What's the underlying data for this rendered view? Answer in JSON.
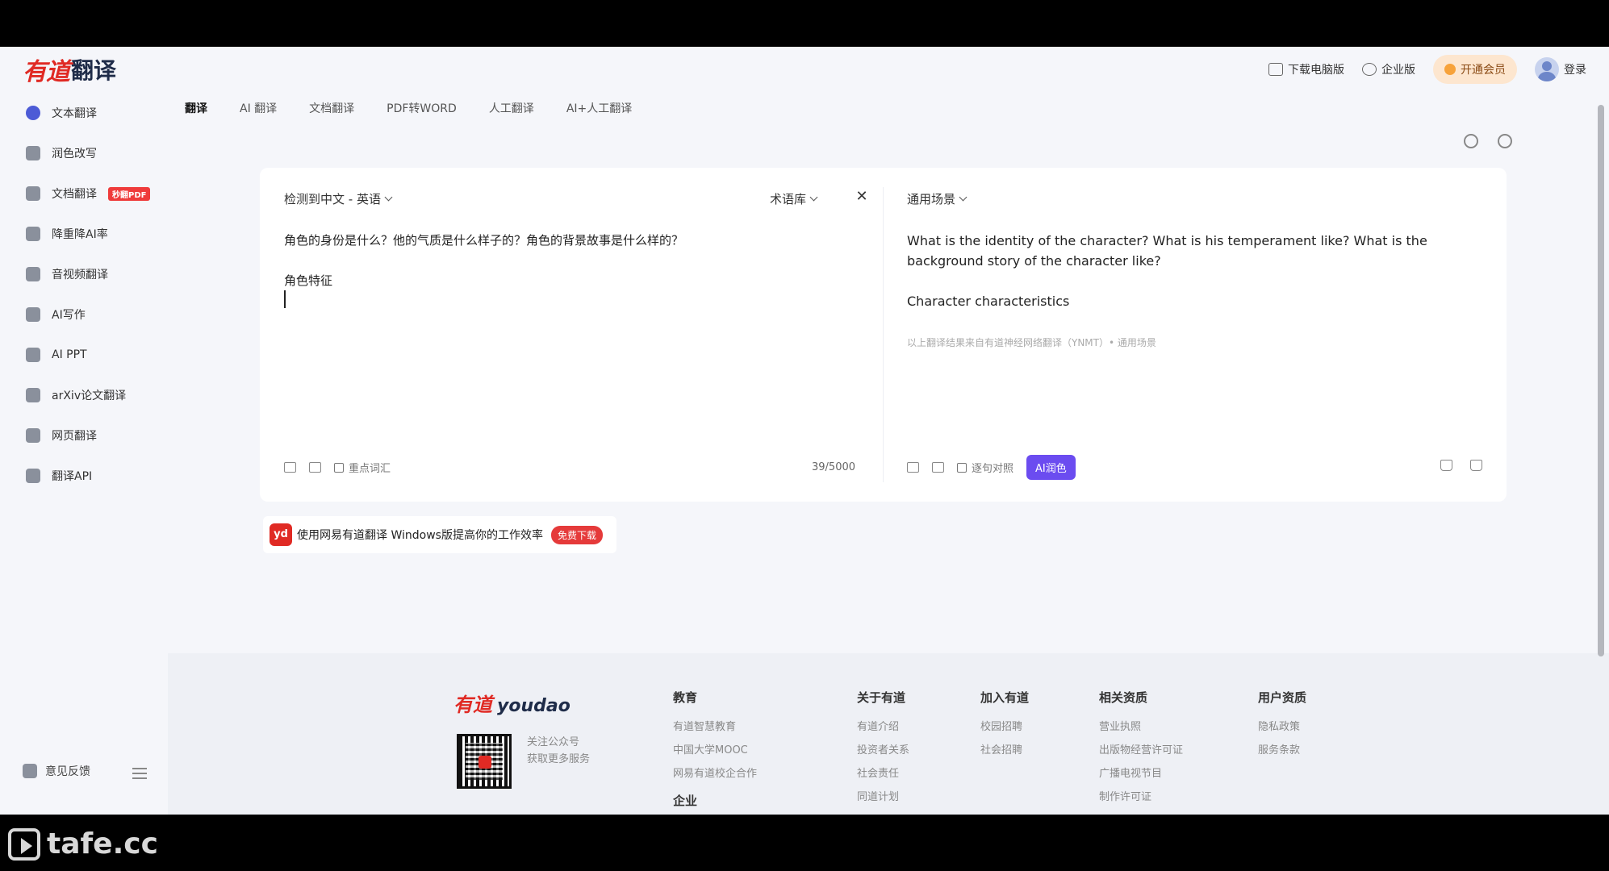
{
  "brand": {
    "logo_mark": "有道",
    "logo_word": "翻译",
    "footer_mark": "有道",
    "footer_word": "youdao"
  },
  "topbar": {
    "download_pc": "下载电脑版",
    "enterprise": "企业版",
    "vip": "开通会员",
    "login": "登录"
  },
  "sidebar": {
    "items": [
      {
        "label": "文本翻译"
      },
      {
        "label": "润色改写"
      },
      {
        "label": "文档翻译",
        "badge": "秒翻PDF"
      },
      {
        "label": "降重降AI率"
      },
      {
        "label": "音视频翻译"
      },
      {
        "label": "AI写作"
      },
      {
        "label": "AI PPT"
      },
      {
        "label": "arXiv论文翻译"
      },
      {
        "label": "网页翻译"
      },
      {
        "label": "翻译API"
      }
    ],
    "feedback": "意见反馈"
  },
  "tabs": [
    "翻译",
    "AI 翻译",
    "文档翻译",
    "PDF转WORD",
    "人工翻译",
    "AI+人工翻译"
  ],
  "source": {
    "lang_detect": "检测到中文 - 英语",
    "glossary": "术语库",
    "clear_icon": "✕",
    "line1": "角色的身份是什么？他的气质是什么样子的？角色的背景故事是什么样的？",
    "line2": "角色特征",
    "key_vocab": "重点词汇",
    "count": "39/5000"
  },
  "target": {
    "scene": "通用场景",
    "line1": "What is the identity of the character? What is his temperament like? What is the background story of the character like?",
    "line2": "Character characteristics",
    "credit": "以上翻译结果来自有道神经网络翻译（YNMT）• 通用场景",
    "sentence_compare": "逐句对照",
    "ai_polish": "AI润色"
  },
  "promo": {
    "icon": "yd",
    "text": "使用网易有道翻译 Windows版提高你的工作效率",
    "button": "免费下载"
  },
  "footer": {
    "qr_line1": "关注公众号",
    "qr_line2": "获取更多服务",
    "cols": [
      {
        "title": "教育",
        "items": [
          "有道智慧教育",
          "中国大学MOOC",
          "网易有道校企合作"
        ],
        "sub": "企业"
      },
      {
        "title": "关于有道",
        "items": [
          "有道介绍",
          "投资者关系",
          "社会责任",
          "同道计划"
        ]
      },
      {
        "title": "加入有道",
        "items": [
          "校园招聘",
          "社会招聘"
        ]
      },
      {
        "title": "相关资质",
        "items": [
          "营业执照",
          "出版物经营许可证",
          "广播电视节目",
          "制作许可证"
        ]
      },
      {
        "title": "用户资质",
        "items": [
          "隐私政策",
          "服务条款"
        ]
      }
    ]
  },
  "watermark": "tafe.cc",
  "colors": {
    "accent": "#4c5bd6",
    "brand_red": "#e02a24",
    "ai_purple": "#6b4cf0",
    "vip_bg": "#fde6cf"
  }
}
